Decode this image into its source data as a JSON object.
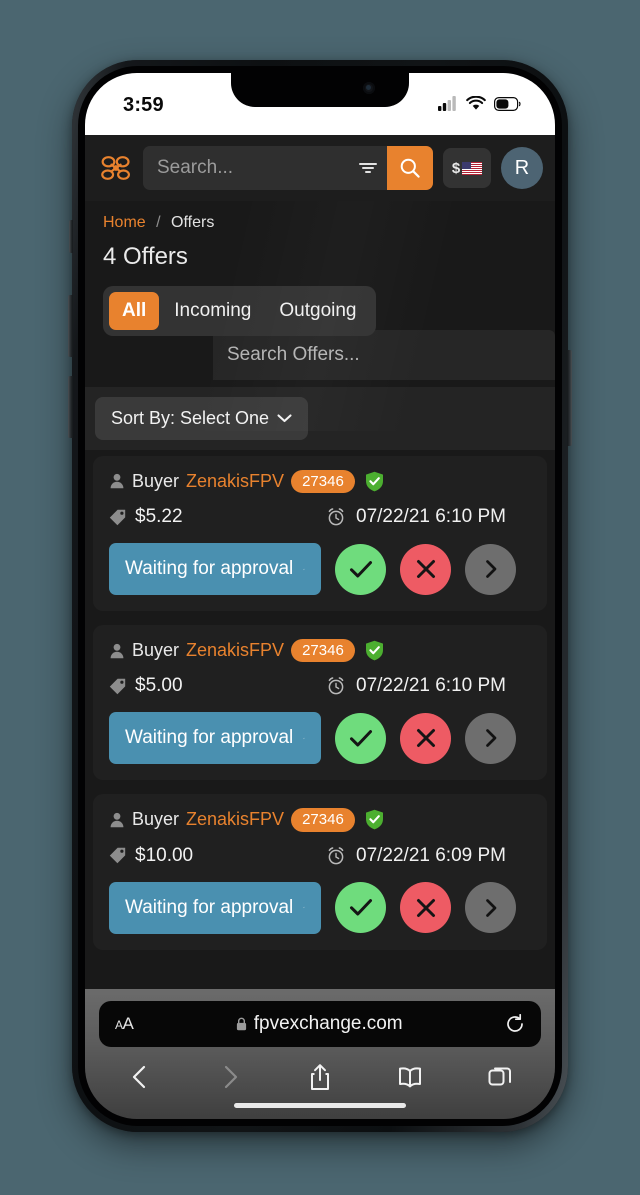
{
  "device": {
    "status_bar": {
      "time": "3:59",
      "signal_icon": "cellular-signal-icon",
      "wifi_icon": "wifi-icon",
      "battery_icon": "battery-icon"
    }
  },
  "header": {
    "logo_icon": "fpv-drone-logo-icon",
    "search": {
      "placeholder": "Search...",
      "value": ""
    },
    "filter_icon": "filter-icon",
    "search_icon": "search-icon",
    "currency": {
      "symbol": "$",
      "flag_icon": "us-flag-icon"
    },
    "avatar_initial": "R",
    "accent_color": "#e8822e"
  },
  "breadcrumb": {
    "home": "Home",
    "separator": "/",
    "current": "Offers"
  },
  "page_title": "4 Offers",
  "tabs": [
    {
      "label": "All",
      "active": true
    },
    {
      "label": "Incoming",
      "active": false
    },
    {
      "label": "Outgoing",
      "active": false
    }
  ],
  "offer_search": {
    "placeholder": "Search Offers...",
    "value": ""
  },
  "sort": {
    "label": "Sort By: Select One",
    "chevron_icon": "chevron-down-icon"
  },
  "offers": [
    {
      "role": "Buyer",
      "username": "ZenakisFPV",
      "user_id": "27346",
      "verified_icon": "verified-shield-icon",
      "price": "$5.22",
      "price_icon": "price-tag-icon",
      "time": "07/22/21 6:10 PM",
      "time_icon": "alarm-clock-icon",
      "status": "Waiting for approval",
      "accept_icon": "check-icon",
      "decline_icon": "x-icon",
      "details_icon": "chevron-right-icon"
    },
    {
      "role": "Buyer",
      "username": "ZenakisFPV",
      "user_id": "27346",
      "verified_icon": "verified-shield-icon",
      "price": "$5.00",
      "price_icon": "price-tag-icon",
      "time": "07/22/21 6:10 PM",
      "time_icon": "alarm-clock-icon",
      "status": "Waiting for approval",
      "accept_icon": "check-icon",
      "decline_icon": "x-icon",
      "details_icon": "chevron-right-icon"
    },
    {
      "role": "Buyer",
      "username": "ZenakisFPV",
      "user_id": "27346",
      "verified_icon": "verified-shield-icon",
      "price": "$10.00",
      "price_icon": "price-tag-icon",
      "time": "07/22/21 6:09 PM",
      "time_icon": "alarm-clock-icon",
      "status": "Waiting for approval",
      "accept_icon": "check-icon",
      "decline_icon": "x-icon",
      "details_icon": "chevron-right-icon"
    }
  ],
  "colors": {
    "accent_orange": "#e8822e",
    "status_blue": "#4a90b0",
    "accept_green": "#6fdc7d",
    "decline_red": "#ee5b64",
    "details_gray": "#6e6e6e",
    "verified_green": "#4caf30",
    "page_bg": "#191919",
    "card_bg": "#202020"
  },
  "browser": {
    "text_size_label": "AA",
    "lock_icon": "lock-icon",
    "url": "fpvexchange.com",
    "reload_icon": "reload-icon",
    "back_icon": "back-chevron-icon",
    "forward_icon": "forward-chevron-icon",
    "share_icon": "share-icon",
    "bookmarks_icon": "book-icon",
    "tabs_icon": "tabs-icon"
  }
}
